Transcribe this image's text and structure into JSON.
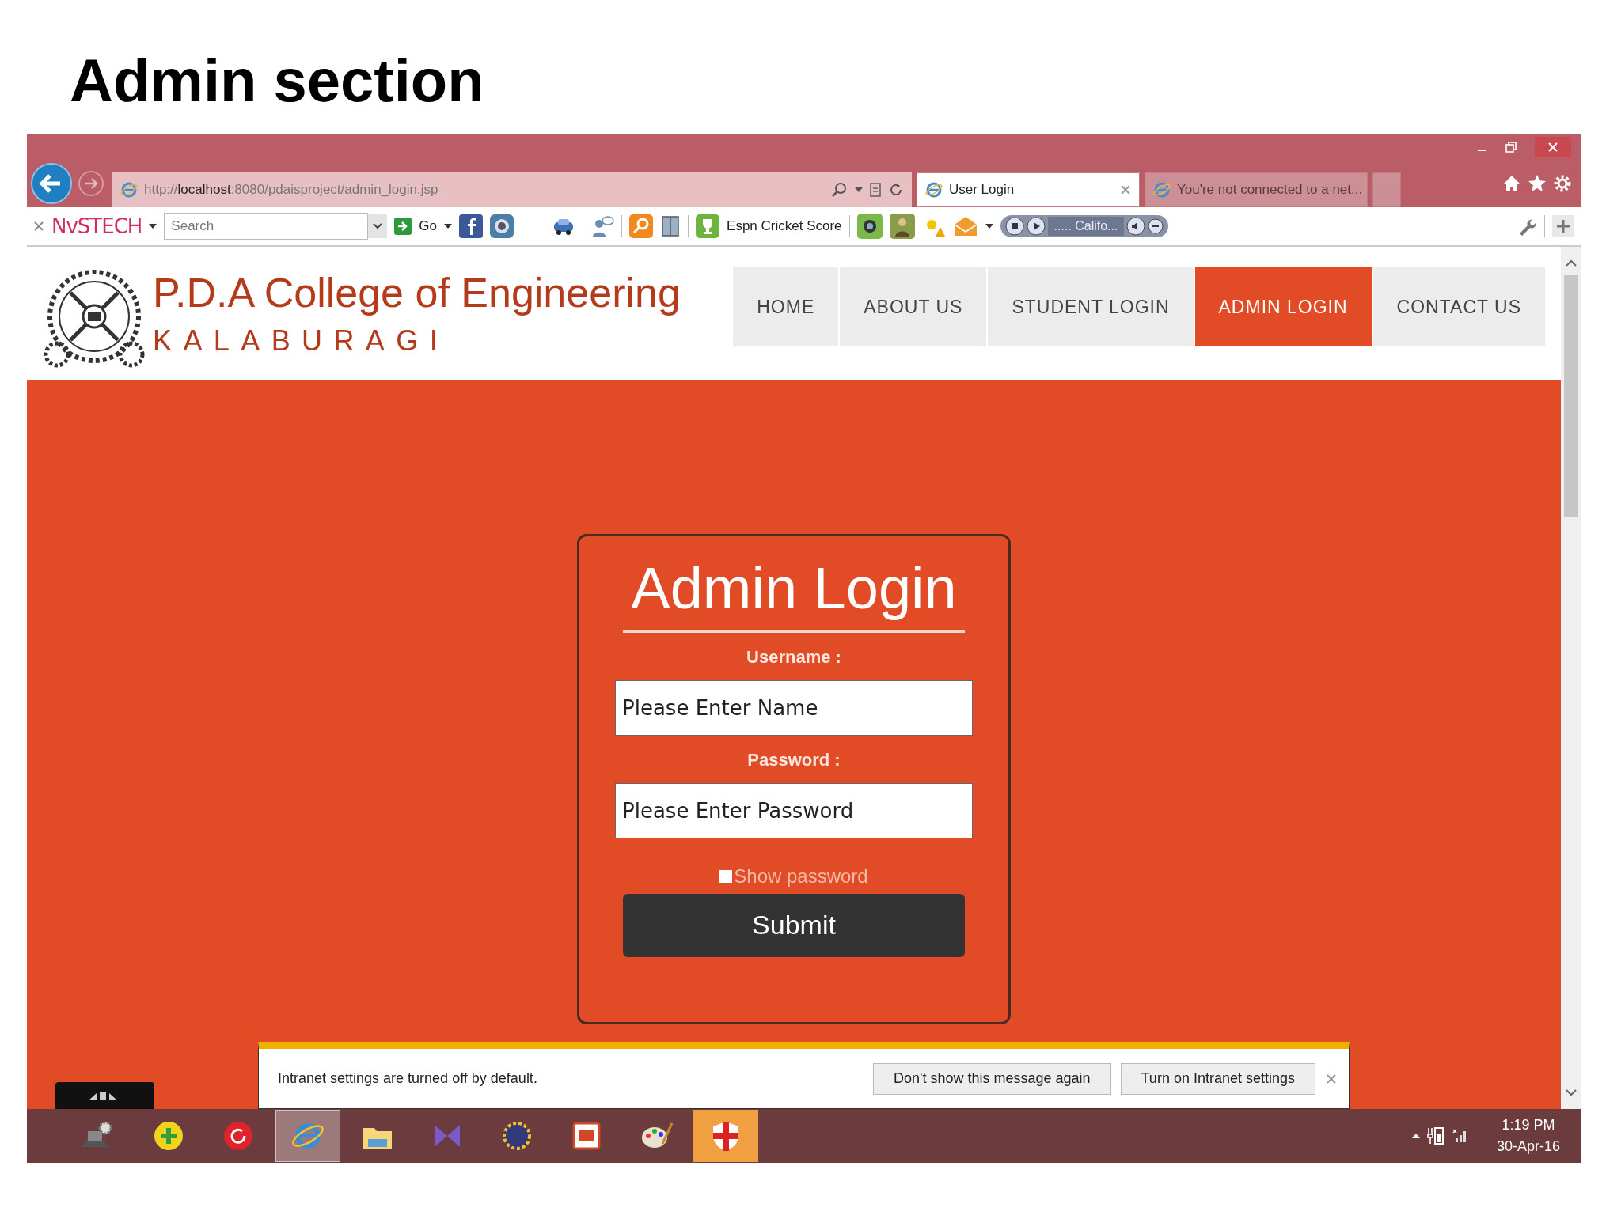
{
  "slide": {
    "title": "Admin section"
  },
  "browser": {
    "address": "http://**localhost**:8080/pdaisproject/admin_login.jsp",
    "tabs": [
      {
        "label": "User Login",
        "selected": true
      },
      {
        "label": "You're not connected to a net...",
        "selected": false
      }
    ],
    "toolbar": {
      "brand": "NvSTECH",
      "search_placeholder": "Search",
      "go": "Go",
      "link": "Espn Cricket Score",
      "station": "..... Califo..."
    }
  },
  "site": {
    "name": "P.D.A College of Engineering",
    "city": "KALABURAGI",
    "nav": [
      {
        "label": "HOME",
        "selected": false
      },
      {
        "label": "ABOUT US",
        "selected": false
      },
      {
        "label": "STUDENT LOGIN",
        "selected": false
      },
      {
        "label": "ADMIN LOGIN",
        "selected": true
      },
      {
        "label": "CONTACT US",
        "selected": false
      }
    ]
  },
  "login": {
    "title": "Admin Login",
    "fields": [
      {
        "label": "Username :",
        "placeholder": "Please Enter Name"
      },
      {
        "label": "Password :",
        "placeholder": "Please Enter Password"
      }
    ],
    "show_password": {
      "label": "Show password",
      "checked": false
    },
    "submit": "Submit"
  },
  "notification": {
    "message": "Intranet settings are turned off by default.",
    "buttons": [
      "Don't show this message again",
      "Turn on Intranet settings"
    ]
  },
  "taskbar": {
    "apps": [
      {
        "kind": "laptop",
        "selected": false
      },
      {
        "kind": "plus",
        "selected": false
      },
      {
        "kind": "refresh",
        "selected": false
      },
      {
        "kind": "browser",
        "selected": true
      },
      {
        "kind": "folder",
        "selected": false
      },
      {
        "kind": "studio",
        "selected": false
      },
      {
        "kind": "gear",
        "selected": false
      },
      {
        "kind": "slides",
        "selected": false
      },
      {
        "kind": "paint",
        "selected": false
      },
      {
        "kind": "shield",
        "selected": false
      }
    ],
    "time": "1:19 PM",
    "date": "30-Apr-16"
  }
}
